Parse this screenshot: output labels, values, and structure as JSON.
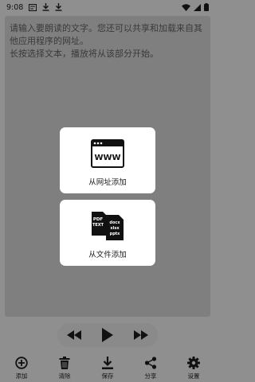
{
  "status_bar": {
    "time": "9:08",
    "left_icons": [
      "notification-icon",
      "download-icon",
      "download-complete-icon"
    ],
    "right_icons": [
      "wifi-icon",
      "signal-icon",
      "battery-icon"
    ]
  },
  "text_input": {
    "placeholder": "请输入要朗读的文字。您还可以共享和加载来自其他应用程序的网址。\n长按选择文本，播放将从该部分开始。"
  },
  "cards": {
    "url": {
      "icon_text": "WWW",
      "label": "从网址添加"
    },
    "file": {
      "icon_text_left": "PDF\nTEXT",
      "icon_text_right": "docx\nxlsx\npptx",
      "label": "从文件添加"
    }
  },
  "player": {
    "rewind_icon": "rewind-icon",
    "play_icon": "play-icon",
    "forward_icon": "fast-forward-icon"
  },
  "bottom_nav": {
    "items": [
      {
        "label": "添加",
        "icon": "add-circle-icon"
      },
      {
        "label": "清除",
        "icon": "trash-icon"
      },
      {
        "label": "保存",
        "icon": "save-download-icon"
      },
      {
        "label": "分享",
        "icon": "share-icon"
      },
      {
        "label": "设置",
        "icon": "gear-icon"
      }
    ]
  },
  "colors": {
    "overlay_background": "#8f8f8f",
    "text_area": "#7f7f7f",
    "card": "#ffffff",
    "icon_dark": "#111111"
  }
}
